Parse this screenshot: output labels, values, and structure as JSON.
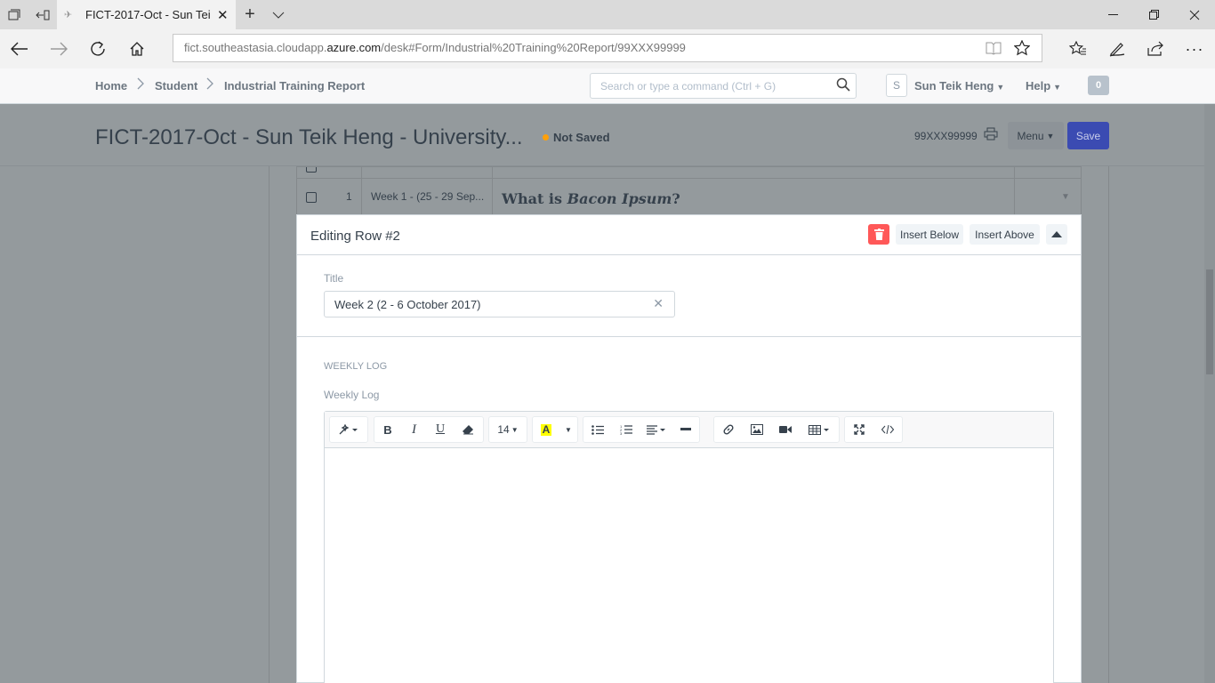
{
  "browser": {
    "tab_title": "FICT-2017-Oct - Sun Tei",
    "url_prefix": "fict.southeastasia.cloudapp.",
    "url_domain": "azure.com",
    "url_path": "/desk#Form/Industrial%20Training%20Report/99XXX99999"
  },
  "breadcrumb": {
    "home": "Home",
    "student": "Student",
    "report": "Industrial Training Report"
  },
  "search": {
    "placeholder": "Search or type a command (Ctrl + G)"
  },
  "user": {
    "avatar_letter": "S",
    "name": "Sun Teik Heng"
  },
  "help_label": "Help",
  "notification_count": "0",
  "page": {
    "title": "FICT-2017-Oct - Sun Teik Heng - University...",
    "status": "Not Saved",
    "doc_name": "99XXX99999",
    "menu_label": "Menu",
    "save_label": "Save"
  },
  "grid": {
    "row1": {
      "idx": "1",
      "title": "Week 1 - (25 - 29 Sep...",
      "log_prefix": "What is ",
      "log_italic": "Bacon Ipsum",
      "log_suffix": "?"
    }
  },
  "edit_row": {
    "heading": "Editing Row #2",
    "insert_below": "Insert Below",
    "insert_above": "Insert Above",
    "title_label": "Title",
    "title_value": "Week 2 (2 - 6 October 2017)",
    "section_label": "WEEKLY LOG",
    "log_label": "Weekly Log",
    "font_size": "14"
  },
  "colors": {
    "save": "#3b4bb2",
    "delete": "#ff5858",
    "not_saved_dot": "#ffa00a",
    "highlight": "#ffff00"
  }
}
